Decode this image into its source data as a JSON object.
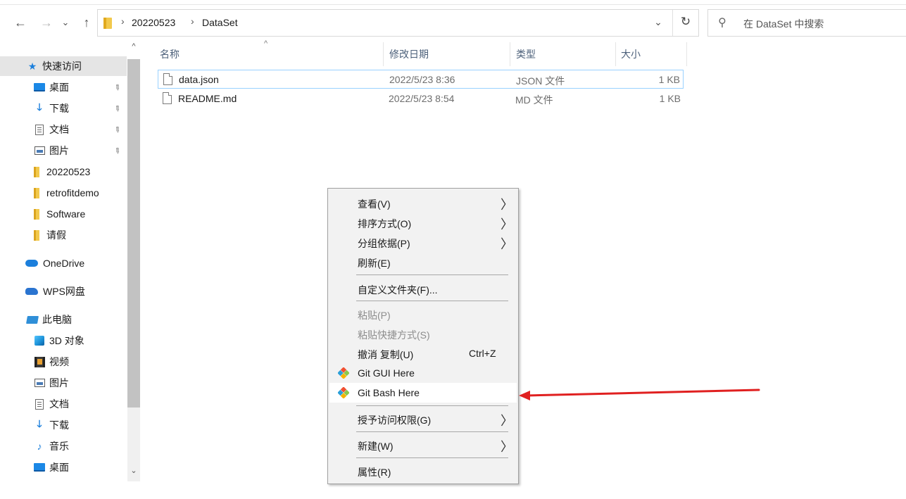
{
  "nav_buttons": {
    "back": "←",
    "forward": "→",
    "recent": "⌄",
    "up": "↑"
  },
  "address_bar": {
    "breadcrumb": [
      "20220523",
      "DataSet"
    ],
    "separator": "›",
    "dropdown": "⌄",
    "refresh": "↻"
  },
  "search": {
    "icon": "⚲",
    "placeholder": "在 DataSet 中搜索"
  },
  "sidebar": {
    "items": [
      {
        "label": "快速访问",
        "icon": "star-icon",
        "pinned": false
      },
      {
        "label": "桌面",
        "icon": "desktop-icon",
        "pinned": true
      },
      {
        "label": "下载",
        "icon": "download-icon",
        "pinned": true
      },
      {
        "label": "文档",
        "icon": "document-icon",
        "pinned": true
      },
      {
        "label": "图片",
        "icon": "picture-icon",
        "pinned": true
      },
      {
        "label": "20220523",
        "icon": "folder-icon",
        "pinned": false
      },
      {
        "label": "retrofitdemo",
        "icon": "folder-icon",
        "pinned": false
      },
      {
        "label": "Software",
        "icon": "folder-icon",
        "pinned": false
      },
      {
        "label": "请假",
        "icon": "folder-icon",
        "pinned": false
      },
      {
        "label": "OneDrive",
        "icon": "cloud-icon",
        "pinned": false
      },
      {
        "label": "WPS网盘",
        "icon": "wps-cloud-icon",
        "pinned": false
      },
      {
        "label": "此电脑",
        "icon": "computer-icon",
        "pinned": false
      },
      {
        "label": "3D 对象",
        "icon": "3d-objects-icon",
        "pinned": false
      },
      {
        "label": "视频",
        "icon": "video-icon",
        "pinned": false
      },
      {
        "label": "图片",
        "icon": "picture-icon",
        "pinned": false
      },
      {
        "label": "文档",
        "icon": "document-icon",
        "pinned": false
      },
      {
        "label": "下载",
        "icon": "download-icon",
        "pinned": false
      },
      {
        "label": "音乐",
        "icon": "music-icon",
        "pinned": false
      },
      {
        "label": "桌面",
        "icon": "desktop-icon",
        "pinned": false
      }
    ],
    "pin_glyph": "📌",
    "scroll_up": "^",
    "scroll_down": "⌄"
  },
  "file_list": {
    "columns": [
      "名称",
      "修改日期",
      "类型",
      "大小"
    ],
    "sort_glyph": "^",
    "rows": [
      {
        "name": "data.json",
        "date": "2022/5/23 8:36",
        "type": "JSON 文件",
        "size": "1 KB"
      },
      {
        "name": "README.md",
        "date": "2022/5/23 8:54",
        "type": "MD 文件",
        "size": "1 KB"
      }
    ]
  },
  "context_menu": {
    "items": [
      {
        "label": "查看(V)",
        "submenu": true
      },
      {
        "label": "排序方式(O)",
        "submenu": true
      },
      {
        "label": "分组依据(P)",
        "submenu": true
      },
      {
        "label": "刷新(E)",
        "submenu": false
      },
      {
        "label": "自定义文件夹(F)...",
        "submenu": false
      },
      {
        "label": "粘贴(P)",
        "disabled": true
      },
      {
        "label": "粘贴快捷方式(S)",
        "disabled": true
      },
      {
        "label": "撤消 复制(U)",
        "shortcut": "Ctrl+Z"
      },
      {
        "label": "Git GUI Here",
        "icon": "git-icon"
      },
      {
        "label": "Git Bash Here",
        "icon": "git-icon",
        "highlighted": true
      },
      {
        "label": "授予访问权限(G)",
        "submenu": true
      },
      {
        "label": "新建(W)",
        "submenu": true
      },
      {
        "label": "属性(R)",
        "submenu": false
      }
    ],
    "arrow_glyph": "〉"
  },
  "annotation": {
    "color": "#e02020",
    "points_to": "Git Bash Here"
  },
  "colors": {
    "folder": "#f2c94c",
    "accent": "#1b7fdc",
    "selection_border": "#99d1ff",
    "git_icon": [
      "#f05133",
      "#2a9fd8",
      "#8cc84b",
      "#f4b400"
    ]
  }
}
